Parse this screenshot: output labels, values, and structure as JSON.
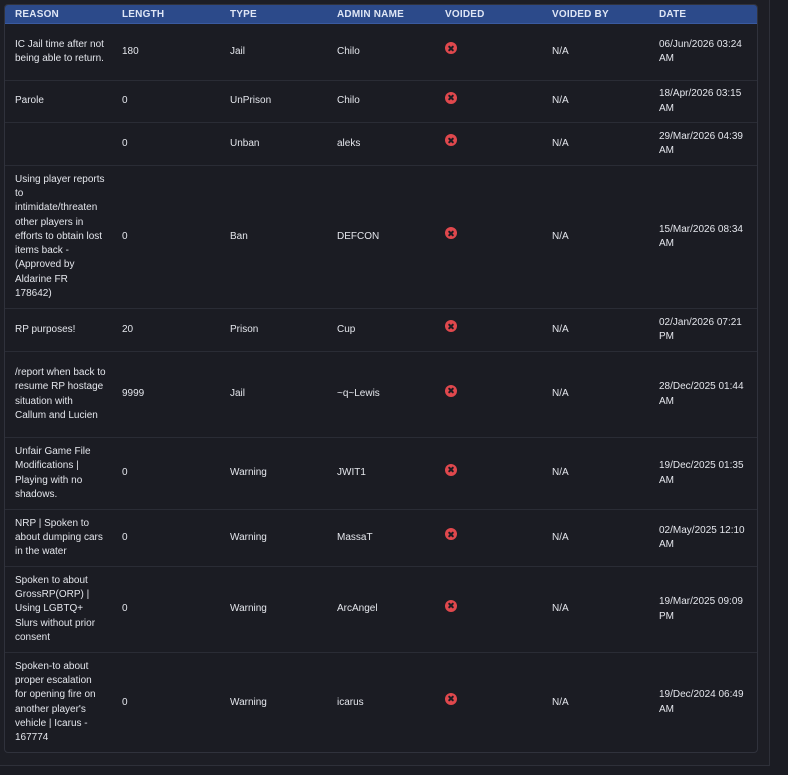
{
  "columns": {
    "reason": "REASON",
    "length": "LENGTH",
    "type": "TYPE",
    "admin": "ADMIN NAME",
    "voided": "VOIDED",
    "voided_by": "VOIDED BY",
    "date": "DATE"
  },
  "rows": [
    {
      "reason": "IC Jail time after not being able to return.",
      "length": "180",
      "type": "Jail",
      "admin": "Chilo",
      "voided": "x-circle-icon",
      "voided_by": "N/A",
      "date": "06/Jun/2026 03:24 AM"
    },
    {
      "reason": "Parole",
      "length": "0",
      "type": "UnPrison",
      "admin": "Chilo",
      "voided": "x-circle-icon",
      "voided_by": "N/A",
      "date": "18/Apr/2026 03:15 AM"
    },
    {
      "reason": "",
      "length": "0",
      "type": "Unban",
      "admin": "aleks",
      "voided": "x-circle-icon",
      "voided_by": "N/A",
      "date": "29/Mar/2026 04:39 AM"
    },
    {
      "reason": "Using player reports to intimidate/threaten other players in efforts to obtain lost items back - (Approved by Aldarine FR 178642)",
      "length": "0",
      "type": "Ban",
      "admin": "DEFCON",
      "voided": "x-circle-icon",
      "voided_by": "N/A",
      "date": "15/Mar/2026 08:34 AM"
    },
    {
      "reason": "RP purposes!",
      "length": "20",
      "type": "Prison",
      "admin": "Cup",
      "voided": "x-circle-icon",
      "voided_by": "N/A",
      "date": "02/Jan/2026 07:21 PM"
    },
    {
      "reason": "/report when back to resume RP hostage situation with Callum and Lucien",
      "length": "9999",
      "type": "Jail",
      "admin": "~q~Lewis",
      "voided": "x-circle-icon",
      "voided_by": "N/A",
      "date": "28/Dec/2025 01:44 AM"
    },
    {
      "reason": "Unfair Game File Modifications | Playing with no shadows.",
      "length": "0",
      "type": "Warning",
      "admin": "JWIT1",
      "voided": "x-circle-icon",
      "voided_by": "N/A",
      "date": "19/Dec/2025 01:35 AM"
    },
    {
      "reason": "NRP | Spoken to about dumping cars in the water",
      "length": "0",
      "type": "Warning",
      "admin": "MassaT",
      "voided": "x-circle-icon",
      "voided_by": "N/A",
      "date": "02/May/2025 12:10 AM"
    },
    {
      "reason": "Spoken to about GrossRP(ORP) | Using LGBTQ+ Slurs without prior consent",
      "length": "0",
      "type": "Warning",
      "admin": "ArcAngel",
      "voided": "x-circle-icon",
      "voided_by": "N/A",
      "date": "19/Mar/2025 09:09 PM"
    },
    {
      "reason": "Spoken-to about proper escalation for opening fire on another player's vehicle | Icarus - 167774",
      "length": "0",
      "type": "Warning",
      "admin": "icarus",
      "voided": "x-circle-icon",
      "voided_by": "N/A",
      "date": "19/Dec/2024 06:49 AM"
    }
  ],
  "colors": {
    "header_bg": "#2c4a8a",
    "void_icon": "#e0484d",
    "background": "#1b1c23"
  }
}
